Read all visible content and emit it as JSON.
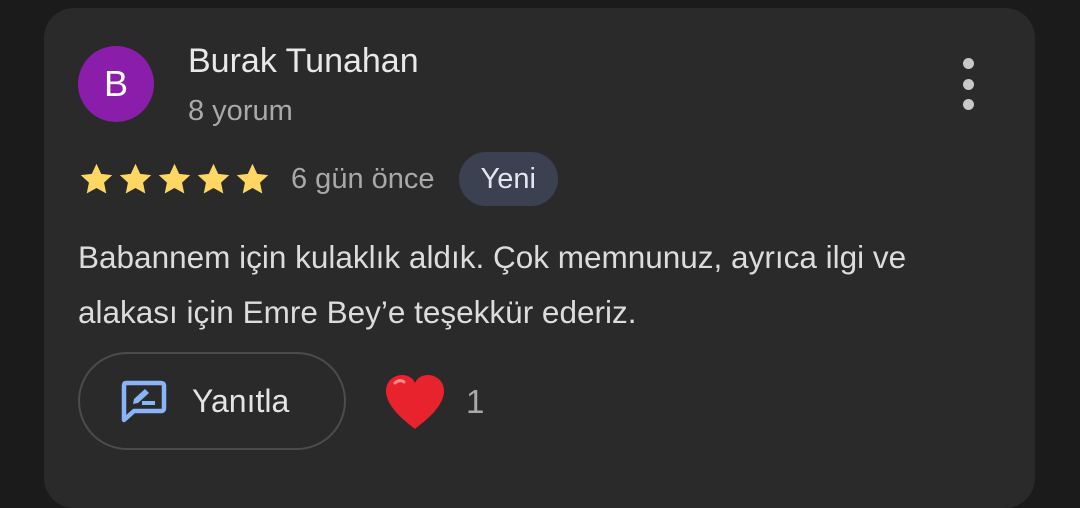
{
  "review": {
    "author": {
      "initial": "B",
      "name": "Burak Tunahan",
      "review_count": "8 yorum",
      "avatar_color": "#8b1dab"
    },
    "rating": 5,
    "rating_max": 5,
    "date": "6 gün önce",
    "badge": "Yeni",
    "text": "Babannem için kulaklık aldık. Çok memnunuz, ayrıca ilgi ve alakası için Emre Bey’e teşekkür ederiz.",
    "more_icon": "more-vert-icon",
    "star_color": "#fdd663"
  },
  "actions": {
    "reply_label": "Yanıtla",
    "reply_icon": "reply-edit-icon",
    "reply_icon_color": "#8ab4f8",
    "reaction_icon": "red-heart-icon",
    "reaction_count": "1"
  }
}
